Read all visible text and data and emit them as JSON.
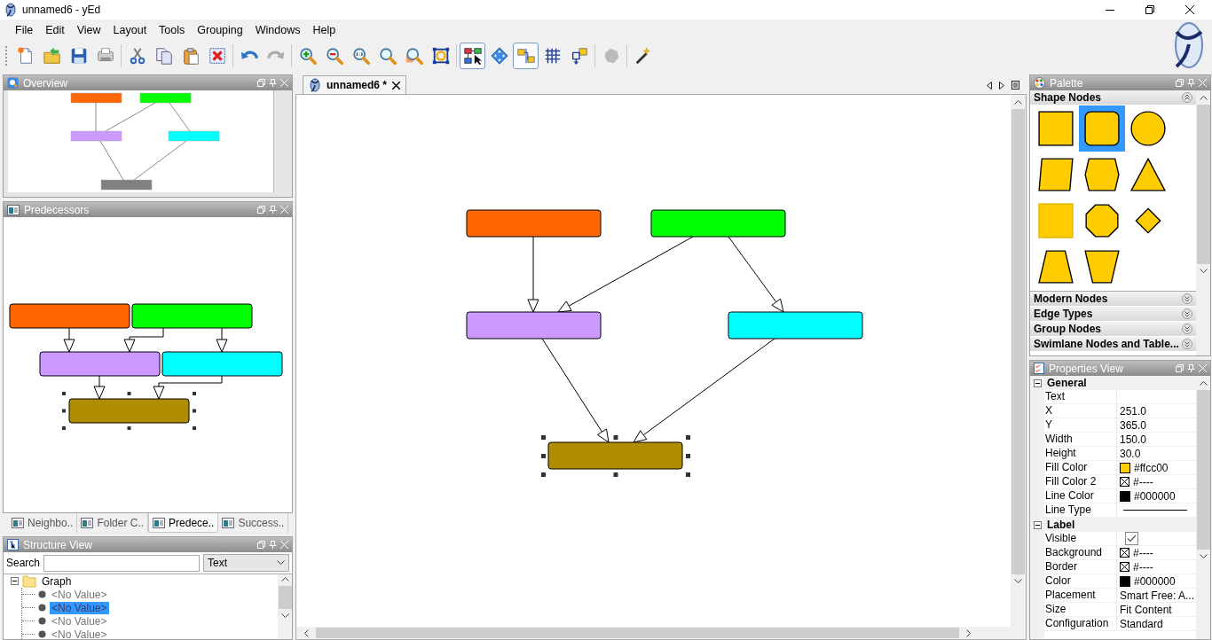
{
  "window": {
    "title": "unnamed6 - yEd"
  },
  "menu": [
    "File",
    "Edit",
    "View",
    "Layout",
    "Tools",
    "Grouping",
    "Windows",
    "Help"
  ],
  "toolbar": [
    {
      "kind": "action",
      "disabled": false
    },
    {
      "kind": "action",
      "disabled": false
    },
    {
      "kind": "action",
      "disabled": false
    },
    {
      "kind": "action",
      "disabled": false
    },
    {
      "kind": "action",
      "disabled": false
    },
    {
      "kind": "action",
      "disabled": false
    },
    {
      "kind": "action",
      "disabled": false
    },
    {
      "kind": "action",
      "disabled": false
    },
    {
      "kind": "action",
      "disabled": false
    },
    {
      "kind": "action",
      "disabled": true
    },
    {
      "kind": "action",
      "disabled": false
    },
    {
      "kind": "action",
      "disabled": false
    },
    {
      "kind": "action",
      "disabled": false
    },
    {
      "kind": "action",
      "disabled": false
    },
    {
      "kind": "action",
      "disabled": false
    },
    {
      "kind": "action",
      "disabled": false
    },
    {
      "kind": "toggle",
      "selected": true
    },
    {
      "kind": "toggle",
      "selected": false
    },
    {
      "kind": "toggle",
      "selected": true
    },
    {
      "kind": "toggle",
      "selected": false
    },
    {
      "kind": "toggle",
      "selected": false
    },
    {
      "kind": "action",
      "disabled": true
    },
    {
      "kind": "action",
      "disabled": false
    }
  ],
  "overview": {
    "title": "Overview"
  },
  "predecessors": {
    "title": "Predecessors"
  },
  "view_tabs": [
    {
      "label": "Neighbo..",
      "selected": false
    },
    {
      "label": "Folder C..",
      "selected": false
    },
    {
      "label": "Predece..",
      "selected": true
    },
    {
      "label": "Success..",
      "selected": false
    }
  ],
  "structure_view": {
    "title": "Structure View",
    "search_label": "Search",
    "filter": "Text",
    "tree": [
      {
        "label": "Graph",
        "expanded": true,
        "selected": false,
        "children": [
          {
            "label": "<No Value>",
            "selected": false
          },
          {
            "label": "<No Value>",
            "selected": true
          },
          {
            "label": "<No Value>",
            "selected": false
          },
          {
            "label": "<No Value>",
            "selected": false
          }
        ]
      }
    ]
  },
  "document_tab": {
    "label": "unnamed6 *"
  },
  "graph": {
    "nodes": [
      {
        "color": "#ff6600",
        "selected": false
      },
      {
        "color": "#00ff00",
        "selected": false
      },
      {
        "color": "#cc99ff",
        "selected": false
      },
      {
        "color": "#00ffff",
        "selected": false
      },
      {
        "color": "#b08c00",
        "selected": true
      }
    ]
  },
  "palette": {
    "title": "Palette",
    "sections": [
      {
        "label": "Shape Nodes",
        "expanded": true,
        "items": [
          {
            "kind": "rectangle",
            "selected": false
          },
          {
            "kind": "roundrect",
            "selected": true
          },
          {
            "kind": "ellipse",
            "selected": false
          },
          {
            "kind": "parallelogram",
            "selected": false
          },
          {
            "kind": "hexagon",
            "selected": false
          },
          {
            "kind": "triangle",
            "selected": false
          },
          {
            "kind": "rectangle3d",
            "selected": false
          },
          {
            "kind": "octagon",
            "selected": false
          },
          {
            "kind": "diamond",
            "selected": false
          },
          {
            "kind": "trapezoid",
            "selected": false
          },
          {
            "kind": "trapezoid2",
            "selected": false
          }
        ]
      },
      {
        "label": "Modern Nodes",
        "expanded": false
      },
      {
        "label": "Edge Types",
        "expanded": false
      },
      {
        "label": "Group Nodes",
        "expanded": false
      },
      {
        "label": "Swimlane Nodes and Table...",
        "expanded": false
      }
    ]
  },
  "properties": {
    "title": "Properties View",
    "groups": [
      {
        "label": "General",
        "expanded": true,
        "rows": [
          {
            "name": "Text",
            "kind": "text"
          },
          {
            "name": "X",
            "kind": "text",
            "value": "251.0"
          },
          {
            "name": "Y",
            "kind": "text",
            "value": "365.0"
          },
          {
            "name": "Width",
            "kind": "text",
            "value": "150.0"
          },
          {
            "name": "Height",
            "kind": "text",
            "value": "30.0"
          },
          {
            "name": "Fill Color",
            "kind": "color",
            "color": "#ffcc00",
            "value": "#ffcc00"
          },
          {
            "name": "Fill Color 2",
            "kind": "none_color",
            "value": "#----"
          },
          {
            "name": "Line Color",
            "kind": "color",
            "color": "#000000",
            "value": "#000000"
          },
          {
            "name": "Line Type",
            "kind": "line"
          }
        ]
      },
      {
        "label": "Label",
        "expanded": true,
        "rows": [
          {
            "name": "Visible",
            "kind": "checkbox",
            "checked": true
          },
          {
            "name": "Background",
            "kind": "none_color",
            "value": "#----"
          },
          {
            "name": "Border",
            "kind": "none_color",
            "value": "#----"
          },
          {
            "name": "Color",
            "kind": "color",
            "color": "#000000",
            "value": "#000000"
          },
          {
            "name": "Placement",
            "kind": "text",
            "value": "Smart Free: A..."
          },
          {
            "name": "Size",
            "kind": "text",
            "value": "Fit Content"
          },
          {
            "name": "Configuration",
            "kind": "text",
            "value": "Standard"
          }
        ]
      }
    ]
  }
}
